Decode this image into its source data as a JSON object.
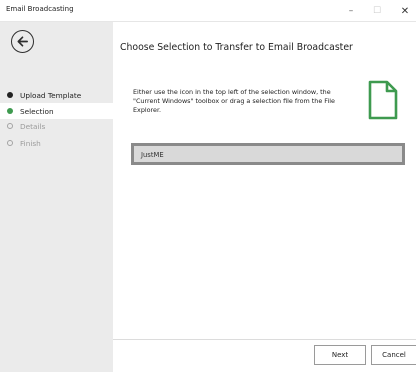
{
  "window": {
    "title": "Email Broadcasting",
    "controls": {
      "minimize": "–",
      "maximize": "☐",
      "close": "✕"
    }
  },
  "sidebar": {
    "back_icon": "circle-arrow-left-icon",
    "steps": [
      {
        "label": "Upload Template",
        "state": "completed"
      },
      {
        "label": "Selection",
        "state": "active"
      },
      {
        "label": "Details",
        "state": "pending"
      },
      {
        "label": "Finish",
        "state": "pending"
      }
    ]
  },
  "main": {
    "title": "Choose Selection to Transfer to Email Broadcaster",
    "instructions": "Either use the icon in the top left of the selection window, the \"Current Windows\" toolbox or drag a selection file from the File Explorer.",
    "file_icon": "document-outline-icon",
    "selection_value": "JustME"
  },
  "footer": {
    "next_label": "Next",
    "cancel_label": "Cancel"
  },
  "colors": {
    "accent_green": "#3e9a4f",
    "sidebar_bg": "#ebebeb",
    "field_bg": "#d9d9d9",
    "field_border": "#8a8a8a"
  }
}
